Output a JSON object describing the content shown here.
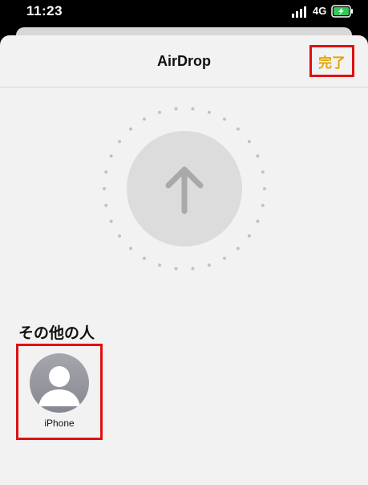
{
  "status_bar": {
    "time": "11:23",
    "network": "4G",
    "icons": [
      "signal-icon",
      "battery-charging-icon"
    ]
  },
  "sheet": {
    "title": "AirDrop",
    "done_label": "完了"
  },
  "radar": {
    "icon": "arrow-up-icon"
  },
  "others": {
    "section_title": "その他の人",
    "devices": [
      {
        "name": "iPhone",
        "icon": "person-avatar-icon"
      }
    ]
  },
  "colors": {
    "accent": "#e0a700",
    "highlight_box": "#e01010",
    "sheet_bg": "#f2f2f3"
  }
}
